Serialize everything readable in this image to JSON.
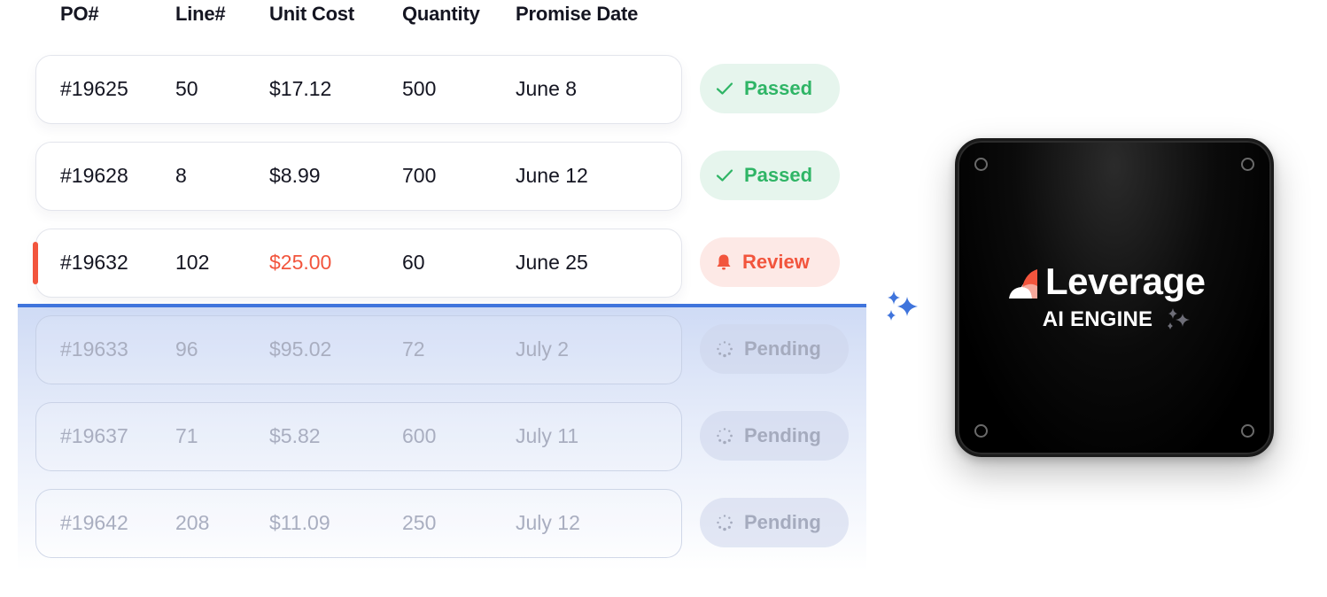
{
  "header": {
    "po": "PO#",
    "line": "Line#",
    "unit_cost": "Unit Cost",
    "quantity": "Quantity",
    "promise_date": "Promise Date"
  },
  "rows": [
    {
      "po": "#19625",
      "line": "50",
      "unit_cost": "$17.12",
      "quantity": "500",
      "promise_date": "June 8",
      "status": "Passed",
      "status_icon": "check-icon"
    },
    {
      "po": "#19628",
      "line": "8",
      "unit_cost": "$8.99",
      "quantity": "700",
      "promise_date": "June 12",
      "status": "Passed",
      "status_icon": "check-icon"
    },
    {
      "po": "#19632",
      "line": "102",
      "unit_cost": "$25.00",
      "quantity": "60",
      "promise_date": "June 25",
      "status": "Review",
      "status_icon": "bell-icon"
    },
    {
      "po": "#19633",
      "line": "96",
      "unit_cost": "$95.02",
      "quantity": "72",
      "promise_date": "July 2",
      "status": "Pending",
      "status_icon": "spinner-icon"
    },
    {
      "po": "#19637",
      "line": "71",
      "unit_cost": "$5.82",
      "quantity": "600",
      "promise_date": "July 11",
      "status": "Pending",
      "status_icon": "spinner-icon"
    },
    {
      "po": "#19642",
      "line": "208",
      "unit_cost": "$11.09",
      "quantity": "250",
      "promise_date": "July 12",
      "status": "Pending",
      "status_icon": "spinner-icon"
    }
  ],
  "engine": {
    "brand": "Leverage",
    "subtitle": "AI ENGINE",
    "icons": [
      "leverage-logo-icon",
      "sparkle-icon"
    ]
  },
  "colors": {
    "passed": "#2fb566",
    "passed_bg": "#e6f5ed",
    "review": "#f2553d",
    "review_bg": "#fde9e6",
    "pending": "#a5abbe",
    "scan_line": "#3f74dc",
    "sparkle": "#3f74dc",
    "logo_accent": "#f2553d"
  }
}
